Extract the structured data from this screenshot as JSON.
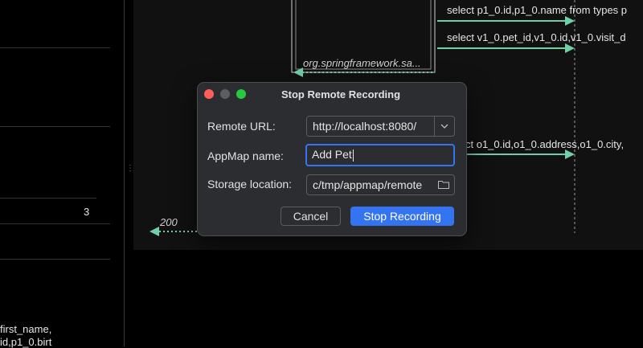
{
  "left_panel": {
    "row_count": "3",
    "text_lines": [
      "first_name,",
      "id,p1_0.birt"
    ]
  },
  "diagram": {
    "messages": [
      "select p1_0.id,p1_0.name from types p",
      "select v1_0.pet_id,v1_0.id,v1_0.visit_d",
      "ct o1_0.id,o1_0.address,o1_0.city,"
    ],
    "return_labels": [
      "org.springframework.sa...",
      "200"
    ],
    "accent_color": "#6fd0a8"
  },
  "dialog": {
    "title": "Stop Remote Recording",
    "remote_url_label": "Remote URL:",
    "remote_url_value": "http://localhost:8080/",
    "appmap_name_label": "AppMap name:",
    "appmap_name_value": "Add Pet",
    "storage_label": "Storage location:",
    "storage_value": "c/tmp/appmap/remote",
    "cancel_label": "Cancel",
    "stop_label": "Stop Recording",
    "primary_color": "#3574f0"
  }
}
